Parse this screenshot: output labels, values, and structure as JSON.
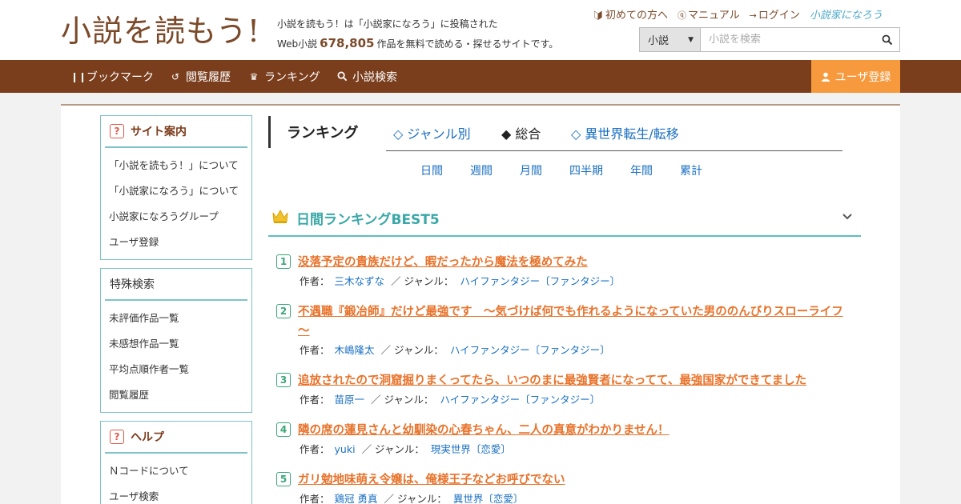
{
  "header": {
    "logo_text": "小説を読もう!",
    "tagline_line1": "小説を読もう！は「小説家になろう」に投稿された",
    "tagline_prefix": "Web小説",
    "tagline_count": "678,805",
    "tagline_suffix": "作品を無料で読める・探せるサイトです。",
    "links": {
      "first_time": "初めての方へ",
      "manual": "マニュアル",
      "login": "ログイン",
      "narou_logo": "小説家になろう"
    },
    "search": {
      "select_value": "小説",
      "placeholder": "小説を検索"
    }
  },
  "nav": {
    "bookmark": "ブックマーク",
    "history": "閲覧履歴",
    "ranking": "ランキング",
    "search": "小説検索",
    "register": "ユーザ登録"
  },
  "sidebar": {
    "site_guide": {
      "title": "サイト案内",
      "items": [
        "「小説を読もう！」について",
        "「小説家になろう」について",
        "小説家になろうグループ",
        "ユーザ登録"
      ]
    },
    "special_search": {
      "title": "特殊検索",
      "items": [
        "未評価作品一覧",
        "未感想作品一覧",
        "平均点順作者一覧",
        "閲覧履歴"
      ]
    },
    "help": {
      "title": "ヘルプ",
      "items": [
        "Ｎコードについて",
        "ユーザ検索"
      ]
    }
  },
  "ranking": {
    "title": "ランキング",
    "tabs": [
      "◇ ジャンル別",
      "◆ 総合",
      "◇ 異世界転生/転移"
    ],
    "active_tab": "◆ 総合",
    "periods": [
      "日間",
      "週間",
      "月間",
      "四半期",
      "年間",
      "累計"
    ],
    "best_title": "日間ランキングBEST5",
    "author_label": "作者：",
    "genre_label": "／ ジャンル：",
    "entries": [
      {
        "rank": "1",
        "title": "没落予定の貴族だけど、暇だったから魔法を極めてみた",
        "author": "三木なずな",
        "genre": "ハイファンタジー〔ファンタジー〕"
      },
      {
        "rank": "2",
        "title": "不遇職『鍛冶師』だけど最強です　～気づけば何でも作れるようになっていた男ののんびりスローライフ～",
        "author": "木嶋隆太",
        "genre": "ハイファンタジー〔ファンタジー〕"
      },
      {
        "rank": "3",
        "title": "追放されたので洞窟掘りまくってたら、いつのまに最強賢者になってて、最強国家ができてました",
        "author": "苗原一",
        "genre": "ハイファンタジー〔ファンタジー〕"
      },
      {
        "rank": "4",
        "title": "隣の席の蓮見さんと幼馴染の心春ちゃん、二人の真意がわかりません！",
        "author": "yuki",
        "genre": "現実世界〔恋愛〕"
      },
      {
        "rank": "5",
        "title": "ガリ勉地味萌え令嬢は、俺様王子などお呼びでない",
        "author": "鶏冠 勇真",
        "genre": "異世界〔恋愛〕"
      }
    ]
  },
  "colors": {
    "brand_brown": "#7a3e1d",
    "accent_orange": "#f79a3e",
    "teal": "#3aa7a7",
    "link_blue": "#1a6fc2",
    "title_orange": "#e8722a"
  }
}
